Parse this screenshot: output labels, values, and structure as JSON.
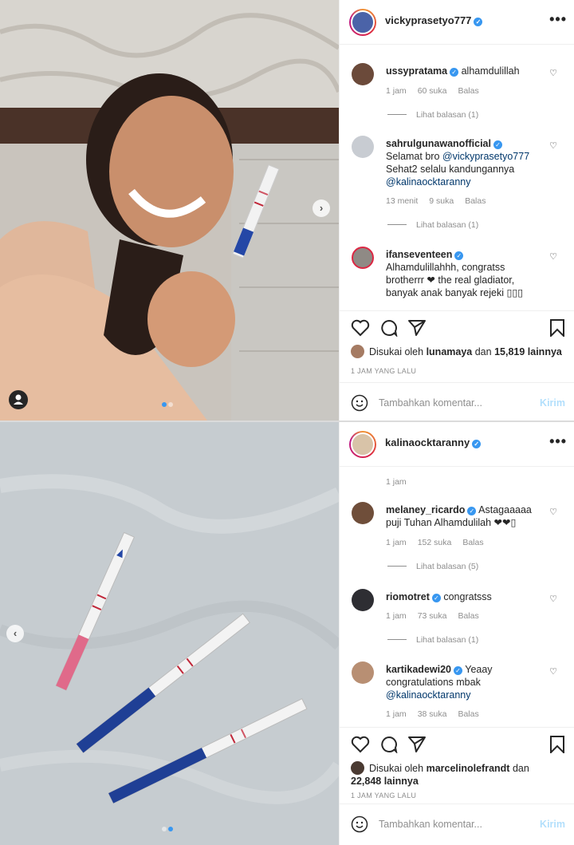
{
  "post1": {
    "author": "vickyprasetyo777",
    "comments": [
      {
        "user": "ussypratama",
        "verified": true,
        "text": "alhamdulillah",
        "time": "1 jam",
        "likes": "60 suka",
        "reply": "Balas",
        "replies": "Lihat balasan (1)"
      },
      {
        "user": "sahrulgunawanofficial",
        "verified": true,
        "text_a": "Selamat bro ",
        "mention1": "@vickyprasetyo777",
        "text_b": " Sehat2 selalu kandungannya ",
        "mention2": "@kalinaocktaranny",
        "time": "13 menit",
        "likes": "9 suka",
        "reply": "Balas",
        "replies": "Lihat balasan (1)"
      },
      {
        "user": "ifanseventeen",
        "verified": true,
        "text": "Alhamdulillahhh, congratss brotherrr ❤ the real gladiator, banyak anak banyak rejeki ▯▯▯"
      }
    ],
    "liked_by_prefix": "Disukai oleh",
    "liked_by_user": "lunamaya",
    "liked_by_mid": "dan",
    "liked_by_count": "15,819 lainnya",
    "timestamp": "1 JAM YANG LALU",
    "add_comment_placeholder": "Tambahkan komentar...",
    "send_label": "Kirim"
  },
  "post2": {
    "author": "kalinaocktaranny",
    "caption_time": "1 jam",
    "comments": [
      {
        "user": "melaney_ricardo",
        "verified": true,
        "text": "Astagaaaaa puji Tuhan Alhamdulilah ❤❤▯",
        "time": "1 jam",
        "likes": "152 suka",
        "reply": "Balas",
        "replies": "Lihat balasan (5)"
      },
      {
        "user": "riomotret",
        "verified": true,
        "text": "congratsss",
        "time": "1 jam",
        "likes": "73 suka",
        "reply": "Balas",
        "replies": "Lihat balasan (1)"
      },
      {
        "user": "kartikadewi20",
        "verified": true,
        "text_a": "Yeaay congratulations mbak ",
        "mention1": "@kalinaocktaranny",
        "time": "1 jam",
        "likes": "38 suka",
        "reply": "Balas"
      }
    ],
    "liked_by_prefix": "Disukai oleh",
    "liked_by_user": "marcelinolefrandt",
    "liked_by_mid": "dan",
    "liked_by_count": "22,848 lainnya",
    "timestamp": "1 JAM YANG LALU",
    "add_comment_placeholder": "Tambahkan komentar...",
    "send_label": "Kirim"
  },
  "icons": {
    "verified": "verified-badge-icon",
    "more": "more-options-icon",
    "heart": "heart-icon",
    "comment": "comment-icon",
    "share": "paper-plane-icon",
    "save": "bookmark-icon",
    "emoji": "emoji-icon"
  },
  "glyphs": {
    "verified": "✓",
    "more": "•••",
    "heart": "♡",
    "next": "›",
    "prev": "‹"
  },
  "colors": {
    "verified": "#3897f0",
    "send_disabled": "#b2dffc",
    "link": "#00376b",
    "meta": "#8e8e8e"
  }
}
